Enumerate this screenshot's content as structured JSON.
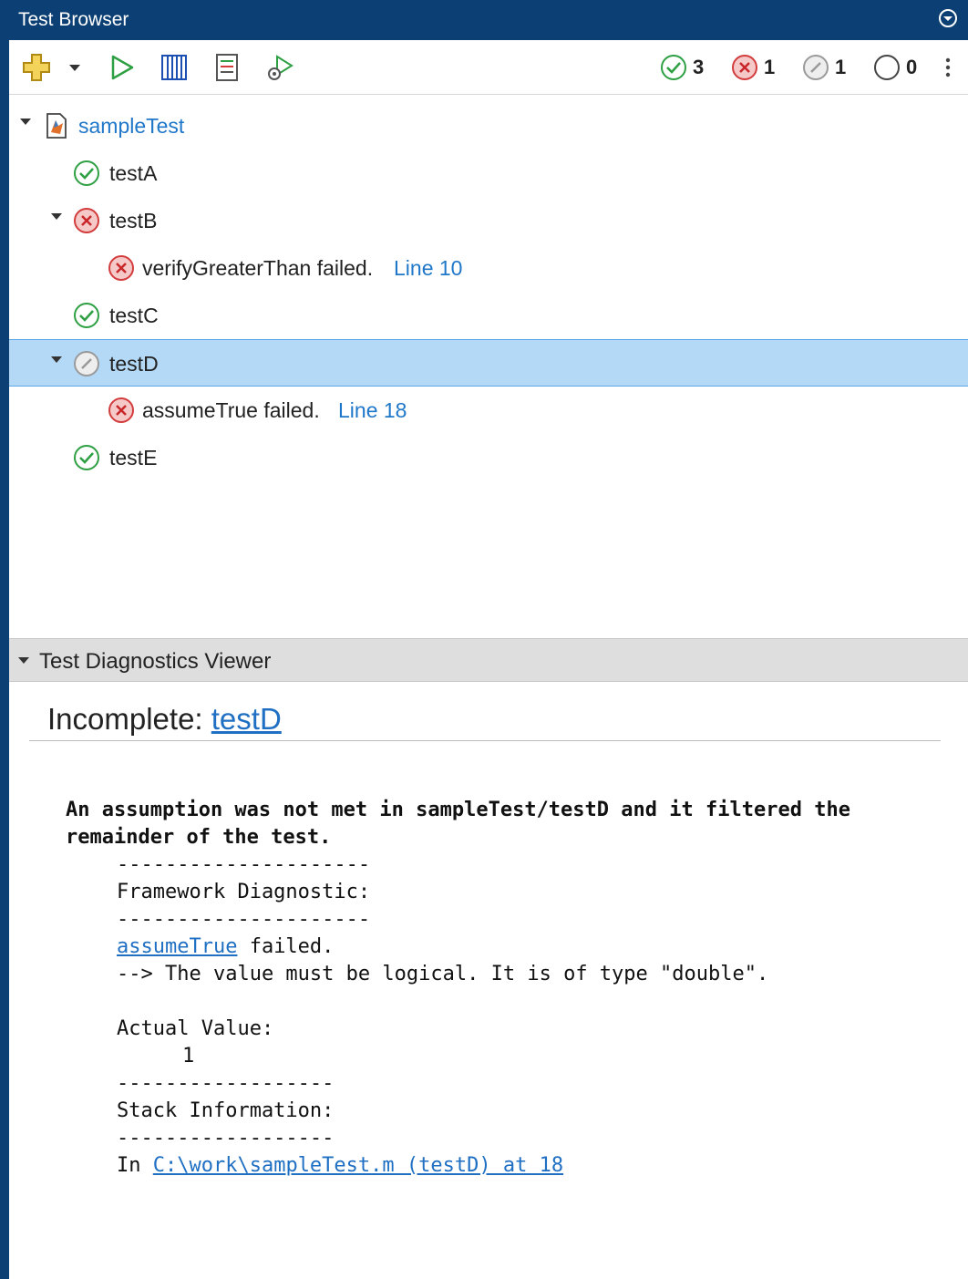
{
  "window": {
    "title": "Test Browser"
  },
  "toolbar": {
    "tools": [
      "add-icon",
      "dropdown-icon",
      "run-icon",
      "columns-icon",
      "report-icon",
      "settings-icon"
    ],
    "counts": {
      "passed": "3",
      "failed": "1",
      "incomplete": "1",
      "not_run": "0"
    }
  },
  "tree": {
    "root": {
      "label": "sampleTest"
    },
    "items": [
      {
        "label": "testA",
        "status": "passed"
      },
      {
        "label": "testB",
        "status": "failed",
        "detail": {
          "text": "verifyGreaterThan failed.",
          "link": "Line 10"
        }
      },
      {
        "label": "testC",
        "status": "passed"
      },
      {
        "label": "testD",
        "status": "incomplete",
        "detail": {
          "text": "assumeTrue failed.",
          "link": "Line 18"
        }
      },
      {
        "label": "testE",
        "status": "passed"
      }
    ],
    "selected": "testD"
  },
  "diagnostics": {
    "header": "Test Diagnostics Viewer",
    "heading_prefix": "Incomplete: ",
    "heading_link": "testD",
    "message_line1": "An assumption was not met in sampleTest/testD and it filtered the",
    "message_line2": "remainder of the test.",
    "separator_long": "---------------------",
    "framework_label": "Framework Diagnostic:",
    "assume_link": "assumeTrue",
    "assume_suffix": " failed.",
    "value_message": "--> The value must be logical. It is of type \"double\".",
    "actual_label": "Actual Value:",
    "actual_value": "1",
    "separator_short": "------------------",
    "stack_label": "Stack Information:",
    "stack_prefix": "In ",
    "stack_link": "C:\\work\\sampleTest.m (testD) at 18"
  },
  "colors": {
    "title_bar": "#0c3f73",
    "passed": "#2ea043",
    "failed": "#d23c3c",
    "incomplete": "#9a9a9a",
    "selection": "#b3d9f7",
    "link": "#1f77c9"
  }
}
